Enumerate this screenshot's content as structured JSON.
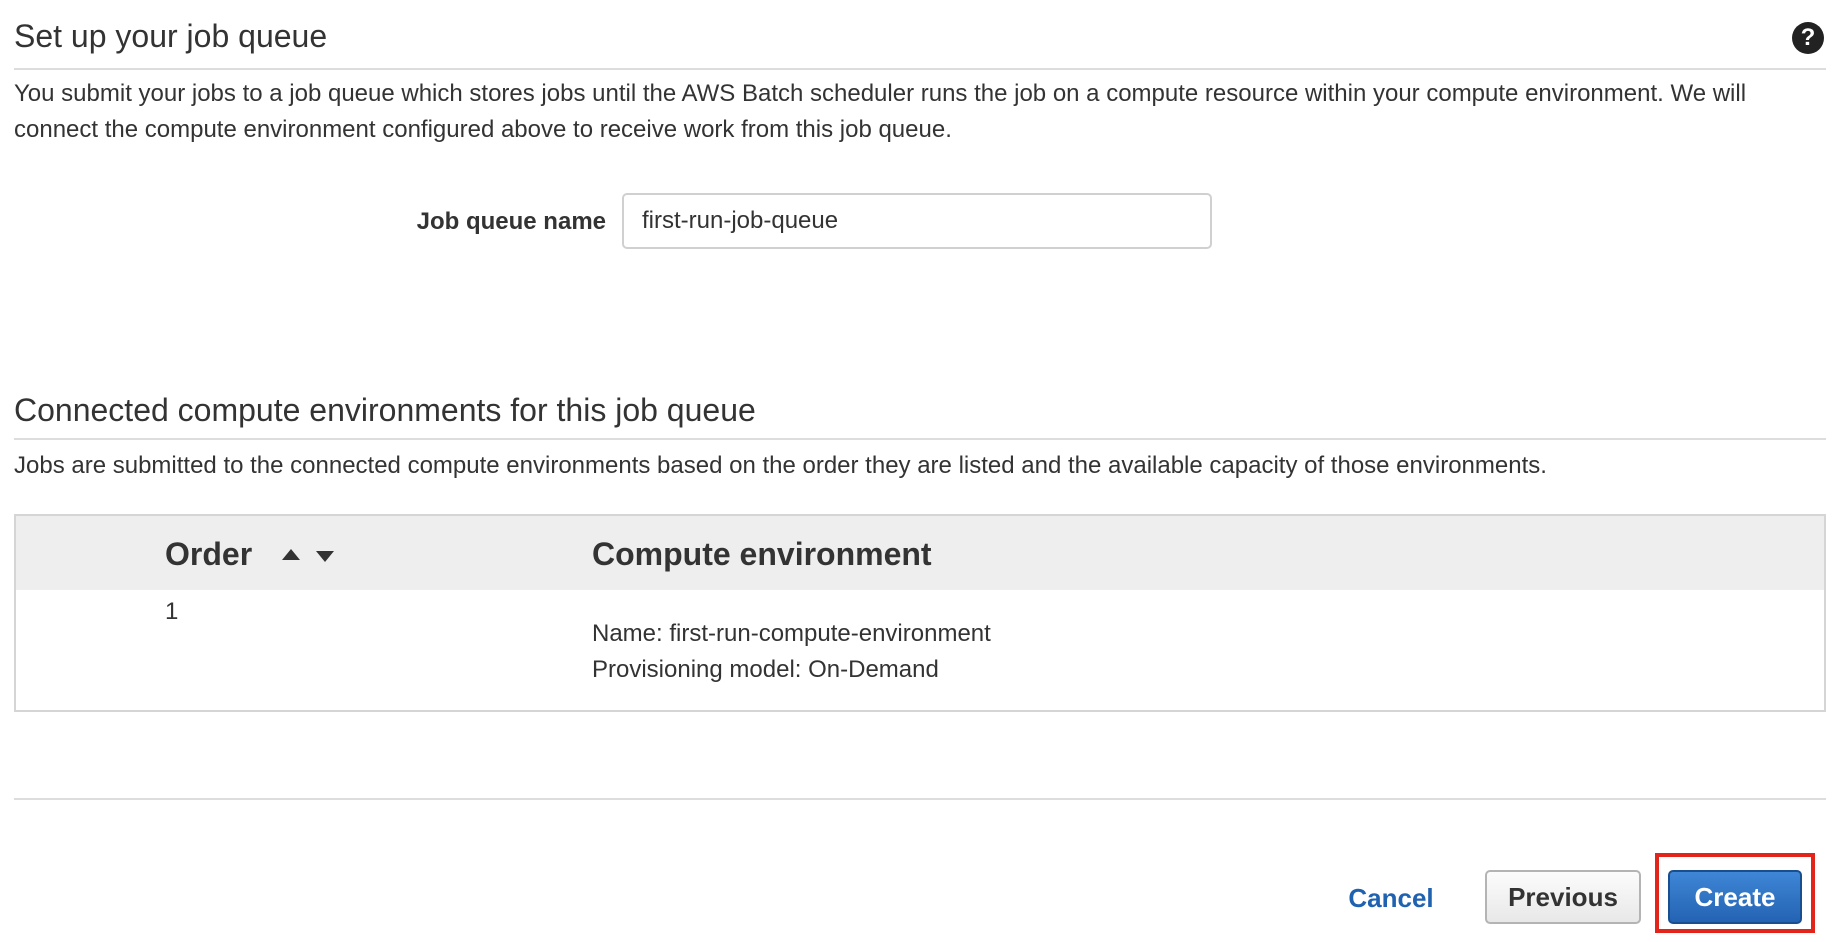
{
  "job_queue_section": {
    "title": "Set up your job queue",
    "description": "You submit your jobs to a job queue which stores jobs until the AWS Batch scheduler runs the job on a compute resource within your compute environment. We will connect the compute environment configured above to receive work from this job queue.",
    "help_icon": "question-circle-icon",
    "help_glyph": "?"
  },
  "job_queue_form": {
    "label": "Job queue name",
    "value": "first-run-job-queue"
  },
  "environments_section": {
    "title": "Connected compute environments for this job queue",
    "description": "Jobs are submitted to the connected compute environments based on the order they are listed and the available capacity of those environments."
  },
  "environments_table": {
    "columns": {
      "order": "Order",
      "environment": "Compute environment"
    },
    "sort_icons": [
      "sort-up-icon",
      "sort-down-icon"
    ],
    "rows": [
      {
        "order": "1",
        "name_line": "Name: first-run-compute-environment",
        "model_line": "Provisioning model: On-Demand"
      }
    ]
  },
  "footer": {
    "cancel_label": "Cancel",
    "previous_label": "Previous",
    "create_label": "Create"
  },
  "colors": {
    "link_blue": "#1f62b0",
    "primary_button": "#2f74c4",
    "highlight_red": "#e3241b",
    "table_header_bg": "#eeeeee"
  }
}
